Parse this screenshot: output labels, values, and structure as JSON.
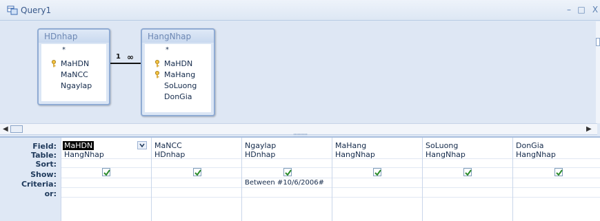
{
  "window": {
    "title": "Query1",
    "minimize_glyph": "–",
    "maximize_glyph": "□",
    "close_glyph": "X"
  },
  "tables": [
    {
      "title": "HDnhap",
      "star": "*",
      "fields": [
        {
          "name": "MaHDN",
          "key": true
        },
        {
          "name": "MaNCC",
          "key": false
        },
        {
          "name": "Ngaylap",
          "key": false
        }
      ]
    },
    {
      "title": "HangNhap",
      "star": "*",
      "fields": [
        {
          "name": "MaHDN",
          "key": true
        },
        {
          "name": "MaHang",
          "key": true
        },
        {
          "name": "SoLuong",
          "key": false
        },
        {
          "name": "DonGia",
          "key": false
        }
      ]
    }
  ],
  "relationship": {
    "one_label": "1",
    "many_label": "∞"
  },
  "grid": {
    "row_labels": {
      "field": "Field:",
      "table": "Table:",
      "sort": "Sort:",
      "show": "Show:",
      "criteria": "Criteria:",
      "or": "or:"
    },
    "columns": [
      {
        "field": "MaHDN",
        "table": "HangNhap",
        "sort": "",
        "show": true,
        "criteria": "",
        "or": "",
        "selected": true
      },
      {
        "field": "MaNCC",
        "table": "HDnhap",
        "sort": "",
        "show": true,
        "criteria": "",
        "or": ""
      },
      {
        "field": "Ngaylap",
        "table": "HDnhap",
        "sort": "",
        "show": true,
        "criteria": "Between #10/6/2006#",
        "or": ""
      },
      {
        "field": "MaHang",
        "table": "HangNhap",
        "sort": "",
        "show": true,
        "criteria": "",
        "or": ""
      },
      {
        "field": "SoLuong",
        "table": "HangNhap",
        "sort": "",
        "show": true,
        "criteria": "",
        "or": ""
      },
      {
        "field": "DonGia",
        "table": "HangNhap",
        "sort": "",
        "show": true,
        "criteria": "",
        "or": ""
      }
    ]
  },
  "colors": {
    "accent": "#8fabd3",
    "background": "#dfe8f5",
    "check": "#2a8a2a"
  }
}
